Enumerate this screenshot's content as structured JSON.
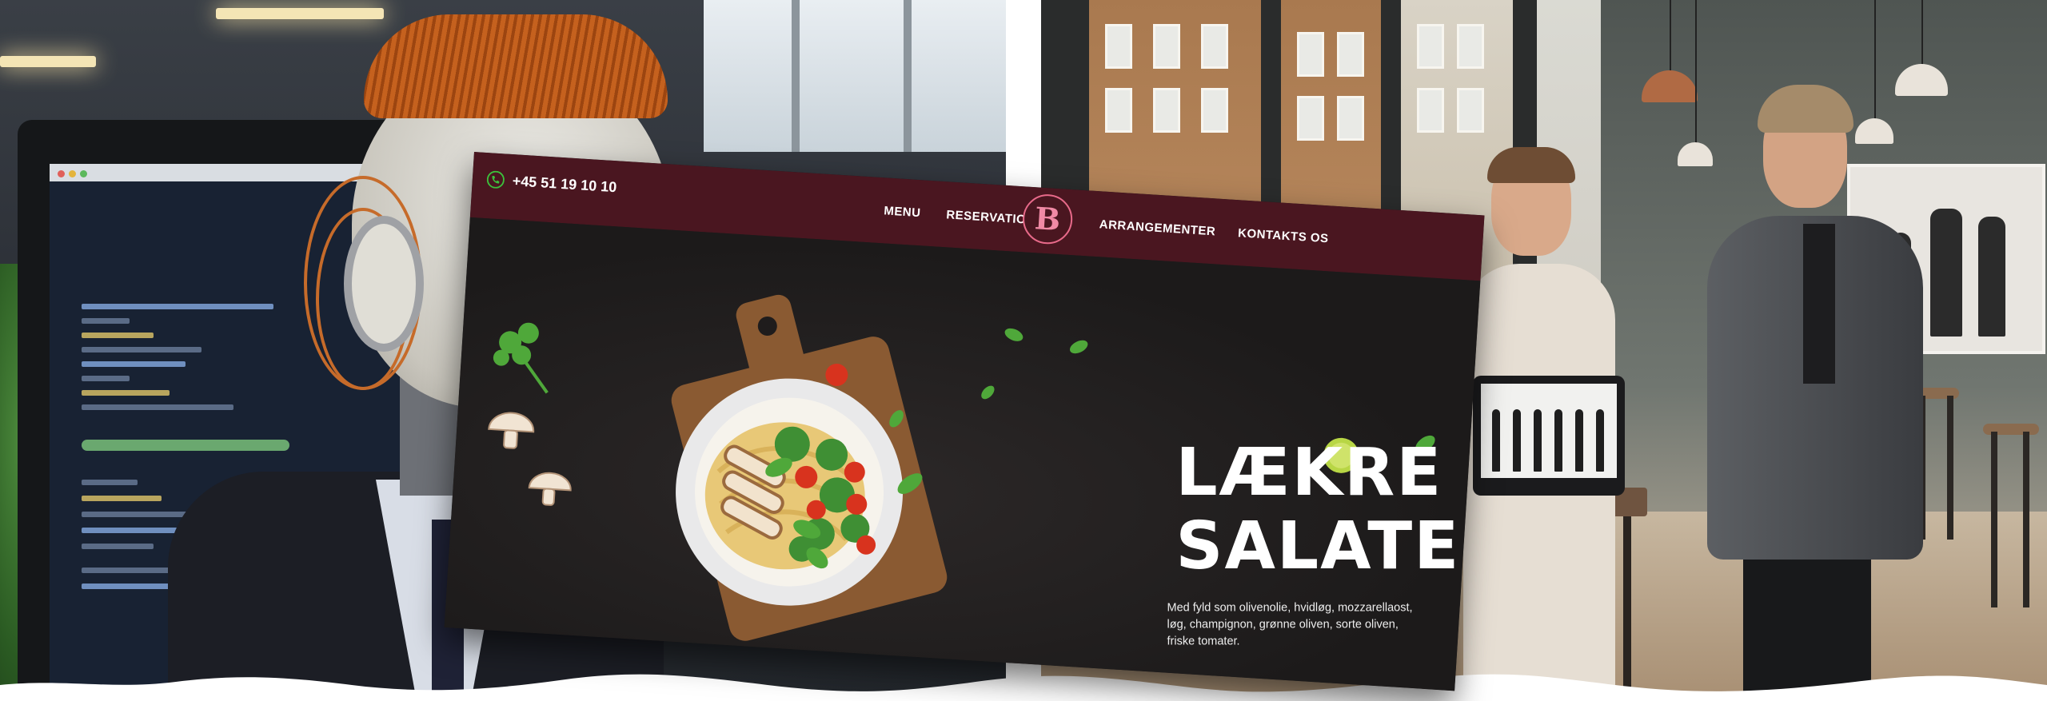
{
  "site": {
    "phone": "+45 51 19 10 10",
    "nav": {
      "menu": "MENU",
      "reservation": "RESERVATION",
      "arrangementer": "ARRANGEMENTER",
      "kontakt": "KONTAKTS OS"
    },
    "logo_letter": "B",
    "hero": {
      "title_line1": "LÆKRE",
      "title_line2": "SALATER",
      "description": "Med fyld som olivenolie, hvidløg, mozzarellaost, løg, champignon, grønne oliven, sorte oliven, friske tomater."
    }
  },
  "colors": {
    "header": "#4a1620",
    "logo_accent": "#f08aa5",
    "hero_background": "#1f1c1c",
    "hero_text": "#ffffff",
    "phone_icon": "#3cc23c"
  },
  "icons": {
    "phone": "phone-icon",
    "logo": "logo-icon"
  }
}
